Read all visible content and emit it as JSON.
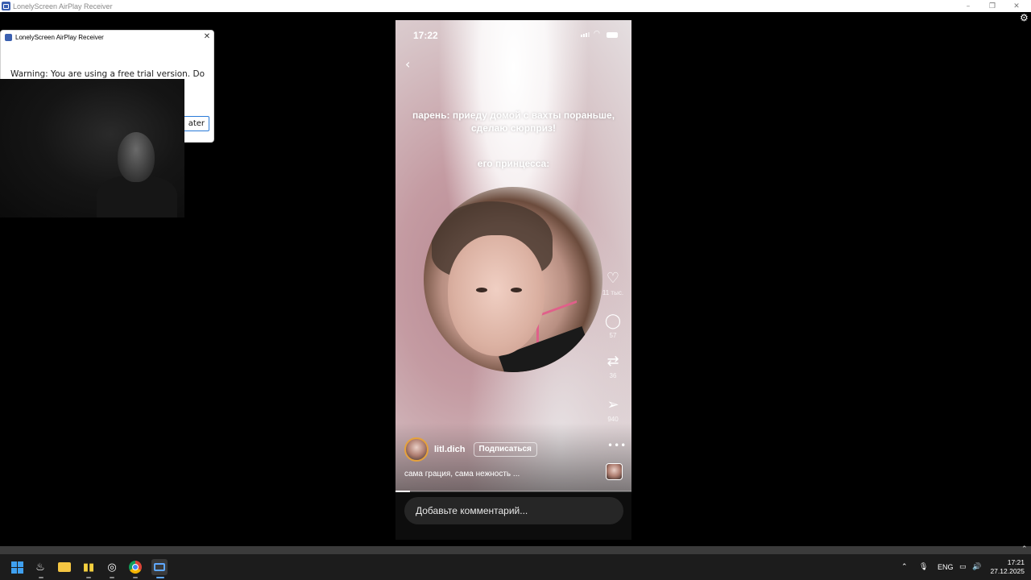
{
  "window": {
    "title": "LonelyScreen AirPlay Receiver",
    "controls": {
      "minimize": "–",
      "maximize": "❐",
      "close": "✕"
    },
    "settings_icon": "gear-icon"
  },
  "dialog": {
    "title": "LonelyScreen AirPlay Receiver",
    "close": "✕",
    "warning": "Warning: You are using a free trial version. Do",
    "later_button": "ater"
  },
  "phone": {
    "status": {
      "time": "17:22"
    },
    "video_caption_1": "парень: приеду домой с вахты пораньше, сделаю сюрприз!",
    "video_caption_2": "его принцесса:",
    "actions": {
      "likes": "11 тыс.",
      "comments": "57",
      "reposts": "36",
      "shares": "940"
    },
    "author": {
      "username": "litl.dich",
      "follow_label": "Подписаться"
    },
    "description": "сама грация, сама нежность ...",
    "progress": 0.06,
    "comment_placeholder": "Добавьте комментарий..."
  },
  "taskbar": {
    "apps": [
      "start",
      "steam",
      "file-explorer",
      "bar-app",
      "obs",
      "chrome",
      "lonelyscreen"
    ],
    "language": "ENG",
    "clock_time": "17:21",
    "clock_date": "27.12.2025"
  }
}
